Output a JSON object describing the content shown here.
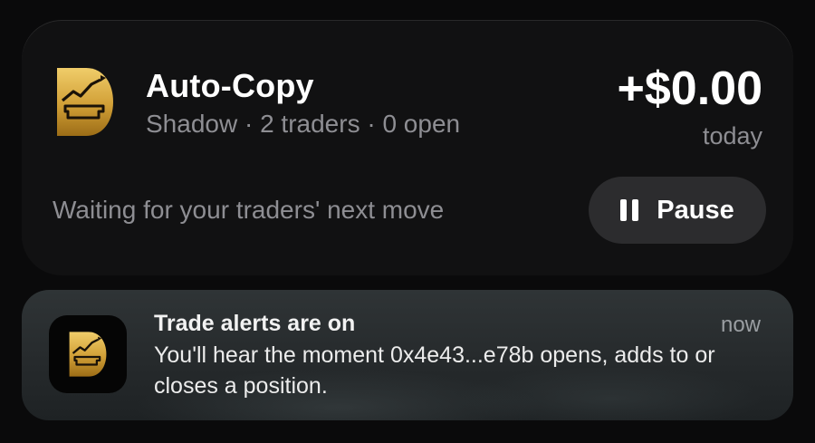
{
  "activity": {
    "title": "Auto-Copy",
    "subtitle": "Shadow · 2 traders · 0 open",
    "pnl_value": "+$0.00",
    "pnl_period": "today",
    "status": "Waiting for your traders' next move",
    "pause_label": "Pause",
    "icon": "app-logo-icon"
  },
  "notification": {
    "title": "Trade alerts are on",
    "time": "now",
    "body": "You'll hear the moment 0x4e43...e78b opens, adds to or closes a position.",
    "icon": "app-logo-icon"
  },
  "colors": {
    "gold_light": "#e8c25a",
    "gold_dark": "#a87a1e",
    "card_bg": "#111112",
    "button_bg": "#2c2c2e",
    "secondary_text": "#8e8e93"
  }
}
